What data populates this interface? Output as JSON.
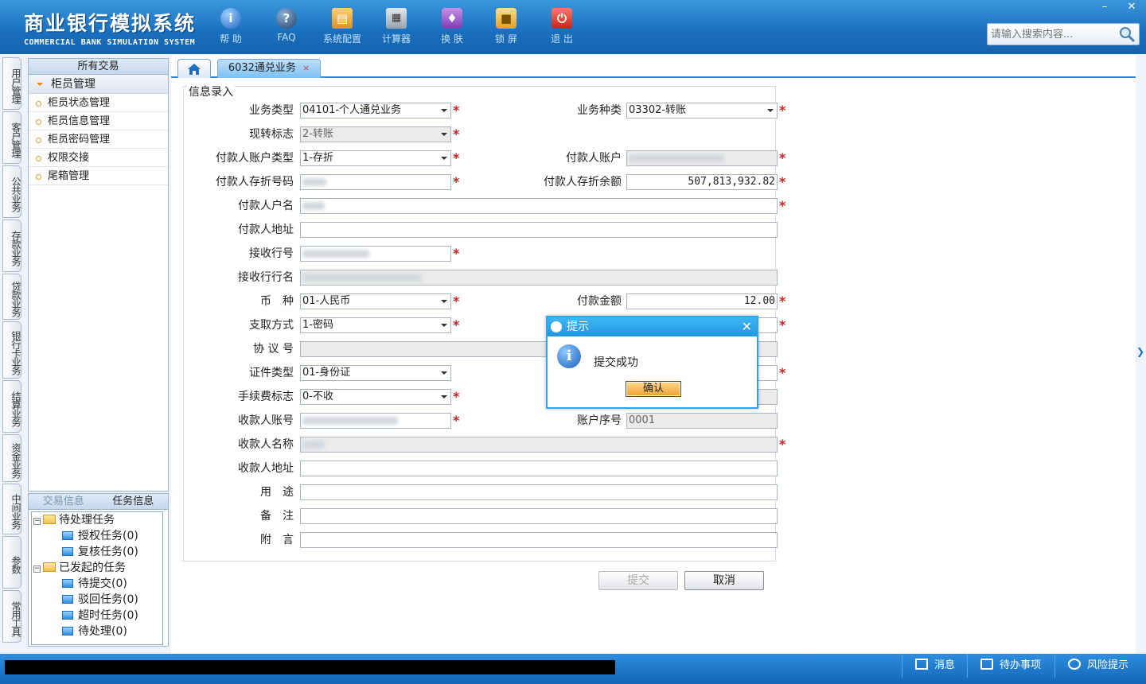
{
  "header": {
    "title": "商业银行模拟系统",
    "subtitle": "COMMERCIAL BANK SIMULATION SYSTEM",
    "toolbar": [
      {
        "label": "帮 助",
        "icon": "help-icon"
      },
      {
        "label": "FAQ",
        "icon": "faq-icon"
      },
      {
        "label": "系统配置",
        "icon": "toolbox-icon"
      },
      {
        "label": "计算器",
        "icon": "calculator-icon"
      },
      {
        "label": "换 肤",
        "icon": "shirt-icon"
      },
      {
        "label": "锁 屏",
        "icon": "lock-icon"
      },
      {
        "label": "退 出",
        "icon": "power-icon"
      }
    ],
    "window": {
      "minimize": "–",
      "close": "✕"
    },
    "search": {
      "placeholder": "请输入搜索内容..."
    }
  },
  "left_tabs": [
    "用户管理",
    "客户管理",
    "公共业务",
    "存款业务",
    "贷款业务",
    "银行卡业务",
    "结算业务",
    "资金业务",
    "中间业务",
    "参数",
    "常用工具"
  ],
  "sidebar": {
    "header": "所有交易",
    "group": "柜员管理",
    "items": [
      "柜员状态管理",
      "柜员信息管理",
      "柜员密码管理",
      "权限交接",
      "尾箱管理"
    ]
  },
  "task_panel": {
    "tabs": [
      "交易信息",
      "任务信息"
    ],
    "tree": [
      {
        "label": "待处理任务",
        "level": 0
      },
      {
        "label": "授权任务(0)",
        "level": 1
      },
      {
        "label": "复核任务(0)",
        "level": 1
      },
      {
        "label": "已发起的任务",
        "level": 0
      },
      {
        "label": "待提交(0)",
        "level": 1
      },
      {
        "label": "驳回任务(0)",
        "level": 1
      },
      {
        "label": "超时任务(0)",
        "level": 1
      },
      {
        "label": "待处理(0)",
        "level": 1
      }
    ]
  },
  "tabs": {
    "active": "6032通兑业务",
    "close": "×"
  },
  "form": {
    "legend": "信息录入",
    "labels": {
      "biz_type": "业务类型",
      "biz_kind": "业务种类",
      "cash_flag": "现转标志",
      "payer_acct_type": "付款人账户类型",
      "payer_acct": "付款人账户",
      "payer_book_no": "付款人存折号码",
      "payer_balance": "付款人存折余额",
      "payer_name": "付款人户名",
      "payer_addr": "付款人地址",
      "recv_bank_no": "接收行号",
      "recv_bank_name": "接收行行名",
      "currency": "币　种",
      "amount": "付款金额",
      "withdraw_method": "支取方式",
      "agreement_no": "协 议 号",
      "id_type": "证件类型",
      "fee_flag": "手续费标志",
      "payee_acct": "收款人账号",
      "acct_seq": "账户序号",
      "payee_name": "收款人名称",
      "payee_addr": "收款人地址",
      "purpose": "用　途",
      "remark": "备　注",
      "postscript": "附　言"
    },
    "values": {
      "biz_type": "04101-个人通兑业务",
      "biz_kind": "03302-转账",
      "cash_flag": "2-转账",
      "payer_acct_type": "1-存折",
      "payer_balance": "507,813,932.82",
      "currency": "01-人民币",
      "amount": "12.00",
      "withdraw_method": "1-密码",
      "id_type": "01-身份证",
      "fee_flag": "0-不收",
      "acct_seq": "0001"
    },
    "buttons": {
      "submit": "提交",
      "cancel": "取消"
    }
  },
  "dialog": {
    "title": "提示",
    "message": "提交成功",
    "ok": "确认"
  },
  "statusbar": {
    "messages": "消息",
    "todo": "待办事项",
    "risk": "风险提示"
  },
  "colors": {
    "header": "#1a6fbd",
    "accent": "#2fa8ea",
    "required": "#d0201f"
  }
}
